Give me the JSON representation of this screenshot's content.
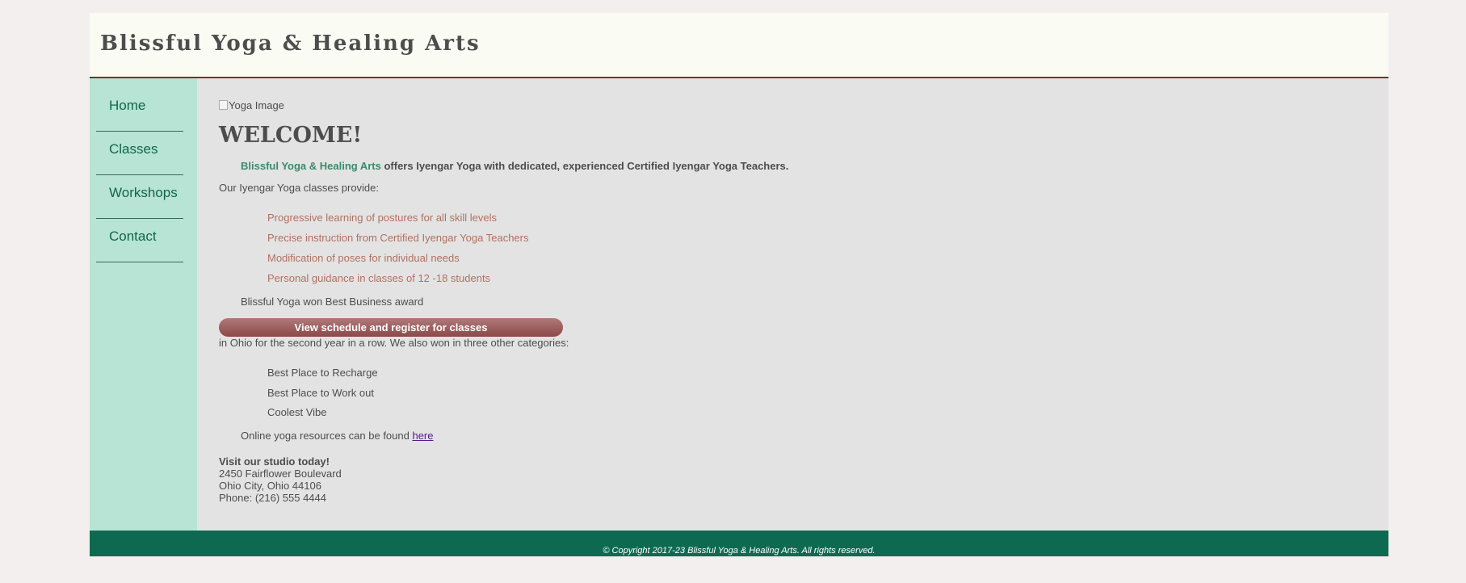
{
  "site": {
    "title": "Blissful Yoga & Healing Arts"
  },
  "nav": {
    "items": [
      {
        "label": "Home"
      },
      {
        "label": "Classes"
      },
      {
        "label": "Workshops"
      },
      {
        "label": "Contact"
      }
    ]
  },
  "main": {
    "hero_alt": "Yoga Image",
    "heading": "WELCOME!",
    "intro_brand": "Blissful Yoga & Healing Arts",
    "intro_rest": " offers Iyengar Yoga with dedicated, experienced Certified Iyengar Yoga Teachers.",
    "provide": "Our Iyengar Yoga classes provide:",
    "benefits": [
      "Progressive learning of postures for all skill levels",
      "Precise instruction from Certified Iyengar Yoga Teachers",
      "Modification of poses for individual needs",
      "Personal guidance in classes of 12 -18 students"
    ],
    "award_lead": "Blissful Yoga won Best Business award",
    "cta_label": "View schedule and register for classes",
    "award_rest": "in Ohio for the second year in a row. We also won in three other categories:",
    "categories": [
      "Best Place to Recharge",
      "Best Place to Work out",
      "Coolest Vibe"
    ],
    "resources_text": "Online yoga resources can be found ",
    "resources_link": "here",
    "visit_heading": "Visit our studio today!",
    "address_line1": "2450 Fairflower Boulevard",
    "address_line2": "Ohio City, Ohio 44106",
    "phone": "Phone: (216) 555 4444"
  },
  "footer": {
    "copyright": "© Copyright 2017-23 Blissful Yoga & Healing Arts. All rights reserved."
  },
  "colors": {
    "header_bg": "#fafbf2",
    "nav_bg": "#b7e4d5",
    "main_bg": "#e3e3e3",
    "footer_bg": "#0d6a50",
    "accent_green": "#3a8a6c",
    "benefit_text": "#b07160",
    "cta_button": "#9a5a5a"
  }
}
